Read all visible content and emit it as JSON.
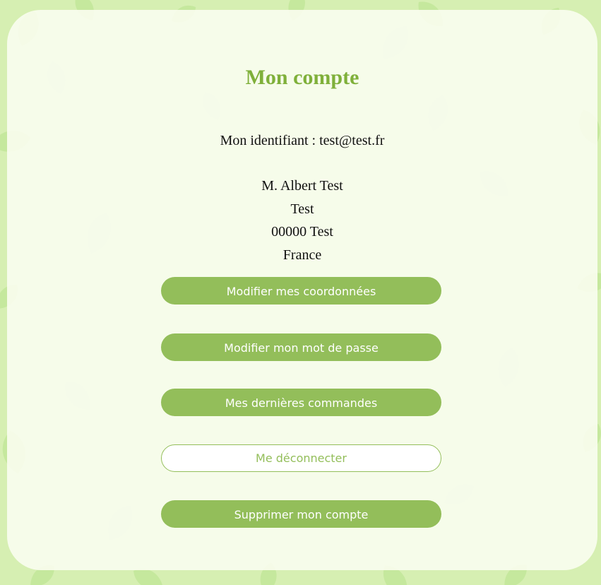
{
  "page": {
    "title": "Mon compte",
    "identifier": "Mon identifiant : test@test.fr"
  },
  "address": {
    "name": "M. Albert Test",
    "street": "Test",
    "city": "00000 Test",
    "country": "France"
  },
  "actions": {
    "edit_details": "Modifier mes coordonnées",
    "edit_password": "Modifier mon mot de passe",
    "orders": "Mes dernières commandes",
    "logout": "Me déconnecter",
    "delete_account": "Supprimer mon compte"
  },
  "colors": {
    "accent": "#93be5a",
    "title": "#7fb03a",
    "background": "#d6efb2",
    "card": "#f9fdf0"
  }
}
